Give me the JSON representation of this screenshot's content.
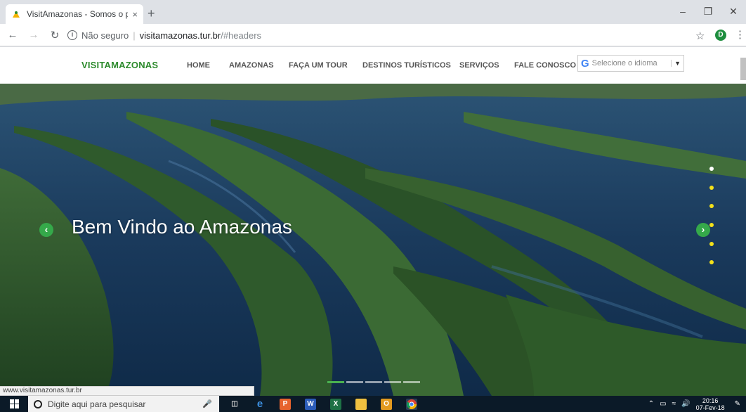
{
  "browser": {
    "tab_title": "VisitAmazonas - Somos o portal",
    "tab_close": "×",
    "new_tab": "+",
    "url_security": "Não seguro",
    "url_host": "visitamazonas.tur.br",
    "url_path": "/#headers",
    "profile_initial": "D",
    "status_url": "www.visitamazonas.tur.br"
  },
  "site": {
    "brand": "VISITAMAZONAS",
    "nav": [
      "HOME",
      "AMAZONAS",
      "FAÇA UM TOUR",
      "DESTINOS TURÍSTICOS",
      "SERVIÇOS",
      "FALE CONOSCO"
    ],
    "language_placeholder": "Selecione o idioma"
  },
  "hero": {
    "title": "Bem Vindo ao Amazonas",
    "prev_icon": "chevron-left-icon",
    "next_icon": "chevron-right-icon",
    "dot_count": 6,
    "active_dot": 0,
    "indicator_count": 5,
    "active_indicator": 0
  },
  "taskbar": {
    "search_placeholder": "Digite aqui para pesquisar",
    "time": "20:16",
    "date": "07-Fev-18"
  },
  "colors": {
    "brand_green": "#2e8b2e",
    "accent_green": "#35a94a",
    "dot_yellow": "#f4e11a"
  }
}
